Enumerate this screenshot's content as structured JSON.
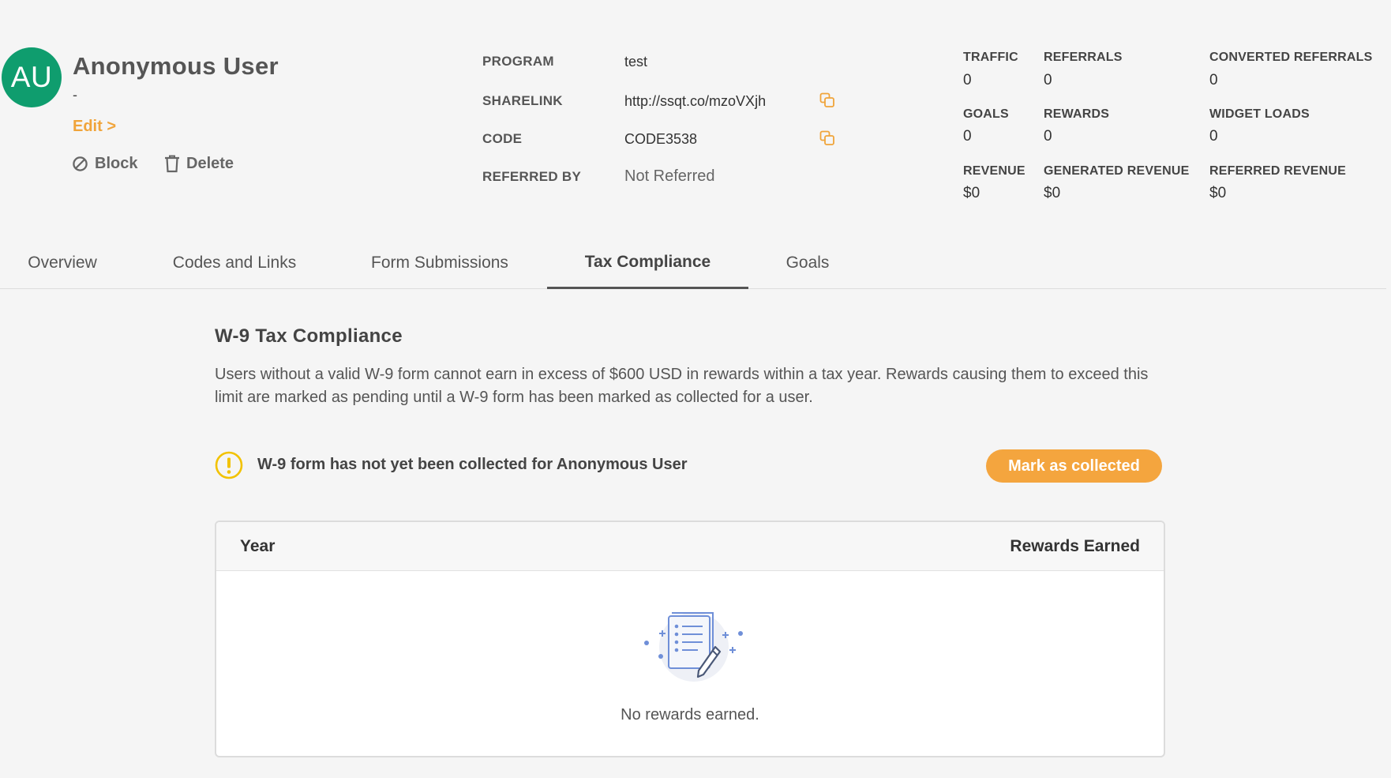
{
  "user": {
    "initials": "AU",
    "name": "Anonymous User",
    "subtitle": "-",
    "edit_label": "Edit >",
    "block_label": "Block",
    "delete_label": "Delete",
    "avatar_color": "#0f9d6e"
  },
  "info": {
    "program_label": "PROGRAM",
    "program_value": "test",
    "sharelink_label": "SHARELINK",
    "sharelink_value": "http://ssqt.co/mzoVXjh",
    "code_label": "CODE",
    "code_value": "CODE3538",
    "referred_label": "REFERRED BY",
    "referred_value": "Not Referred"
  },
  "stats": {
    "traffic_label": "TRAFFIC",
    "traffic_value": "0",
    "referrals_label": "REFERRALS",
    "referrals_value": "0",
    "converted_label": "CONVERTED REFERRALS",
    "converted_value": "0",
    "goals_label": "GOALS",
    "goals_value": "0",
    "rewards_label": "REWARDS",
    "rewards_value": "0",
    "widget_label": "WIDGET LOADS",
    "widget_value": "0",
    "revenue_label": "REVENUE",
    "revenue_value": "$0",
    "generated_label": "GENERATED REVENUE",
    "generated_value": "$0",
    "referred_rev_label": "REFERRED REVENUE",
    "referred_rev_value": "$0"
  },
  "tabs": [
    {
      "label": "Overview"
    },
    {
      "label": "Codes and Links"
    },
    {
      "label": "Form Submissions"
    },
    {
      "label": "Tax Compliance"
    },
    {
      "label": "Goals"
    }
  ],
  "tax": {
    "title": "W-9 Tax Compliance",
    "description": "Users without a valid W-9 form cannot earn in excess of $600 USD in rewards within a tax year. Rewards causing them to exceed this limit are marked as pending until a W-9 form has been marked as collected for a user.",
    "warning": "W-9 form has not yet been collected for Anonymous User",
    "button_label": "Mark as collected",
    "table": {
      "col_year": "Year",
      "col_rewards": "Rewards Earned",
      "empty_text": "No rewards earned."
    }
  },
  "colors": {
    "accent": "#f4a53e",
    "warning": "#f2c200",
    "copy_icon": "#f0a43a"
  }
}
